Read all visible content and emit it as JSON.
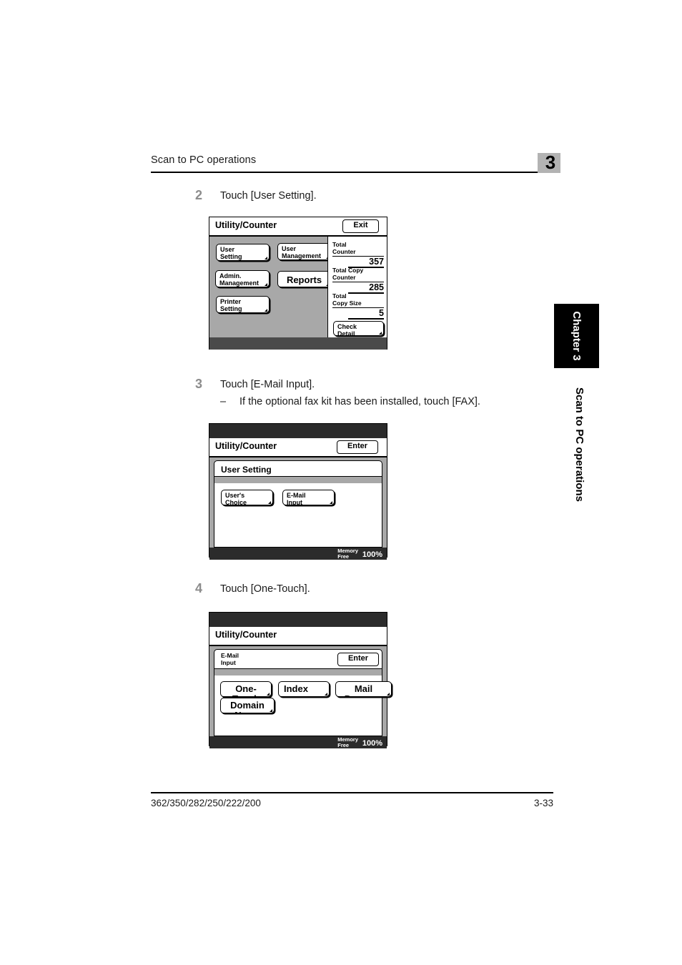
{
  "header": {
    "running_head": "Scan to PC operations",
    "chapter_number": "3"
  },
  "side_tab": {
    "chapter_label": "Chapter 3",
    "running_head": "Scan to PC operations"
  },
  "footer": {
    "models": "362/350/282/250/222/200",
    "page_number": "3-33"
  },
  "steps": [
    {
      "number": "2",
      "text": "Touch [User Setting]."
    },
    {
      "number": "3",
      "text": "Touch [E-Mail Input].",
      "substep_dash": "–",
      "substep_text": "If the optional fax kit has been installed, touch [FAX]."
    },
    {
      "number": "4",
      "text": "Touch [One-Touch]."
    }
  ],
  "panel1": {
    "title": "Utility/Counter",
    "exit_button": "Exit",
    "buttons": [
      {
        "label_line1": "User",
        "label_line2": "Setting"
      },
      {
        "label_line1": "User",
        "label_line2": "Management"
      },
      {
        "label_line1": "Admin.",
        "label_line2": "Management"
      },
      {
        "label_line1": "Reports",
        "label_line2": ""
      },
      {
        "label_line1": "Printer",
        "label_line2": "Setting"
      }
    ],
    "counters": [
      {
        "label_line1": "Total",
        "label_line2": "Counter",
        "value": "357"
      },
      {
        "label_line1": "Total Copy",
        "label_line2": "Counter",
        "value": "285"
      },
      {
        "label_line1": "Total",
        "label_line2": "Copy Size",
        "value": "5"
      }
    ],
    "check_detail_line1": "Check",
    "check_detail_line2": "Detail"
  },
  "panel2": {
    "title": "Utility/Counter",
    "enter_button": "Enter",
    "subwindow_title": "User Setting",
    "buttons": [
      {
        "label_line1": "User's",
        "label_line2": "Choice"
      },
      {
        "label_line1": "E-Mail",
        "label_line2": "Input"
      }
    ],
    "memory_label_line1": "Memory",
    "memory_label_line2": "Free",
    "memory_value": "100%"
  },
  "panel3": {
    "title": "Utility/Counter",
    "enter_button": "Enter",
    "subwindow_title_line1": "E-Mail",
    "subwindow_title_line2": "Input",
    "buttons": [
      {
        "label": "One-Touch"
      },
      {
        "label": "Index"
      },
      {
        "label": "Mail Program"
      },
      {
        "label": "Domain Name"
      }
    ],
    "memory_label_line1": "Memory",
    "memory_label_line2": "Free",
    "memory_value": "100%"
  }
}
